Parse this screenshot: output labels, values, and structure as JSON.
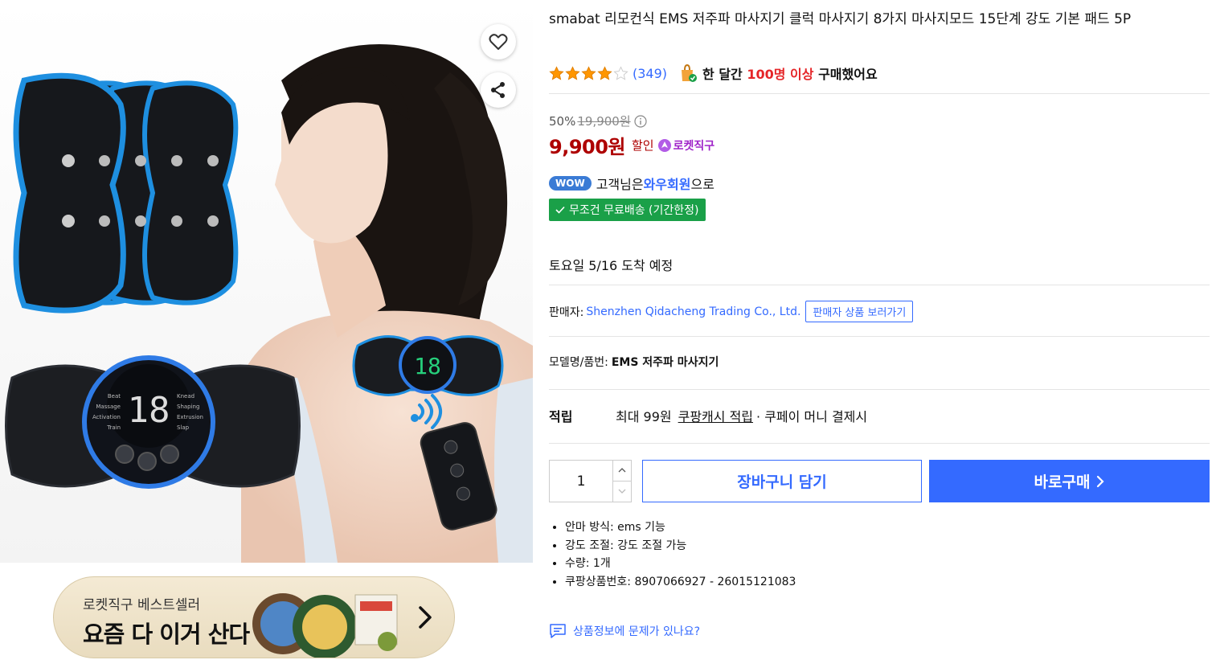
{
  "product": {
    "title": "smabat 리모컨식 EMS 저주파 마사지기 클럭 마사지기 8가지 마사지모드 15단계 강도 기본 패드 5P",
    "rating": 4,
    "rating_max": 5,
    "review_count": "(349)",
    "bought_prefix": "한 달간",
    "bought_highlight": "100명 이상",
    "bought_suffix": "구매했어요"
  },
  "price": {
    "discount_rate": "50%",
    "original": "19,900원",
    "sale": "9,900원",
    "sale_label": "할인",
    "rocket_label": "로켓직구"
  },
  "wow": {
    "badge": "WOW",
    "text_prefix": "고객님은",
    "text_highlight": "와우회원",
    "text_suffix": "으로",
    "shipping_badge": "무조건 무료배송 (기간한정)"
  },
  "delivery": {
    "arrival": "토요일 5/16 도착 예정"
  },
  "seller": {
    "label": "판매자:",
    "name": "Shenzhen Qidacheng Trading Co., Ltd.",
    "button": "판매자 상품 보러가기"
  },
  "model": {
    "label": "모델명/품번:",
    "value": "EMS 저주파 마사지기"
  },
  "reward": {
    "label": "적립",
    "amount": "최대 99원",
    "link": "쿠팡캐시 적립",
    "suffix": "· 쿠페이 머니 결제시"
  },
  "purchase": {
    "quantity": "1",
    "cart_label": "장바구니 담기",
    "buy_label": "바로구매"
  },
  "specs": [
    "안마 방식: ems 기능",
    "강도 조절: 강도 조절 가능",
    "수량: 1개",
    "쿠팡상품번호: 8907066927 - 26015121083"
  ],
  "report": {
    "label": "상품정보에 문제가 있나요?"
  },
  "banner": {
    "subtitle": "로켓직구 베스트셀러",
    "title": "요즘 다 이거 산다"
  },
  "device_display": "18",
  "device_labels": [
    "Beat",
    "Massage",
    "Activation",
    "Train",
    "Knead",
    "Shaping",
    "Extrusion",
    "Slap"
  ],
  "colors": {
    "accent": "#346aff",
    "price_red": "#ae0000",
    "highlight_red": "#e52528",
    "shipping_green": "#1aa048",
    "rocket_purple": "#a024c9",
    "star_orange": "#ff9600"
  },
  "icons": {
    "wish": "heart-icon",
    "share": "share-icon",
    "info": "info-icon",
    "report": "chat-report-icon"
  }
}
